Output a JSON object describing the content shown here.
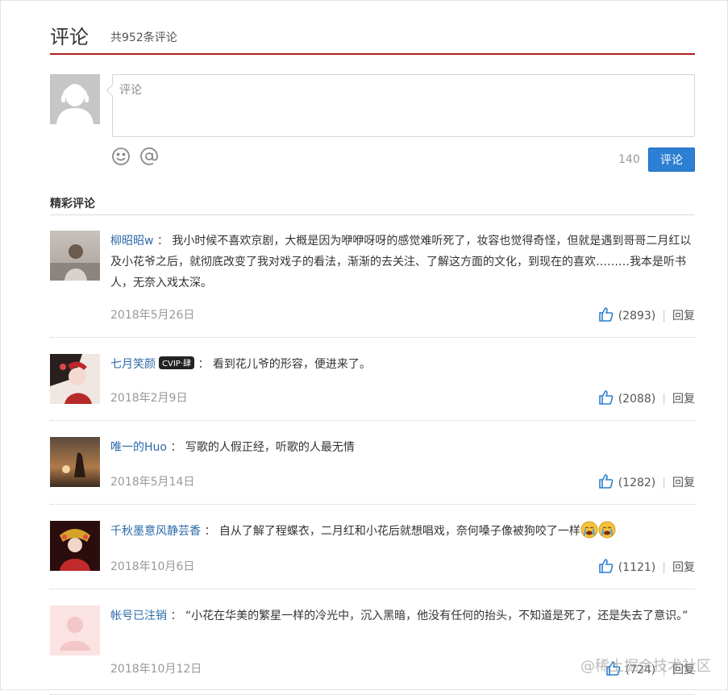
{
  "header": {
    "title": "评论",
    "count_text": "共952条评论"
  },
  "composer": {
    "placeholder": "评论",
    "char_limit": "140",
    "submit_label": "评论",
    "tools": [
      "smiley-icon",
      "at-icon"
    ]
  },
  "section_title": "精彩评论",
  "colors": {
    "accent": "#2c7fd2",
    "divider": "#b31d1d",
    "username": "#2b6aa8"
  },
  "comments": [
    {
      "user": "柳昭昭w",
      "text": "我小时候不喜欢京剧，大概是因为咿咿呀呀的感觉难听死了，妆容也觉得奇怪，但就是遇到哥哥二月红以及小花爷之后，就彻底改变了我对戏子的看法，渐渐的去关注、了解这方面的文化，到现在的喜欢………我本是听书人，无奈入戏太深。",
      "date": "2018年5月26日",
      "likes": "(2893)",
      "reply": "回复"
    },
    {
      "user": "七月笑颜",
      "badge": "CVIP·肆",
      "text": "看到花儿爷的形容，便进来了。",
      "date": "2018年2月9日",
      "likes": "(2088)",
      "reply": "回复"
    },
    {
      "user": "唯一的Huo",
      "text": "写歌的人假正经，听歌的人最无情",
      "date": "2018年5月14日",
      "likes": "(1282)",
      "reply": "回复"
    },
    {
      "user": "千秋墨意风静芸香",
      "text": "自从了解了程蝶衣，二月红和小花后就想唱戏，奈何嗓子像被狗咬了一样",
      "emoji": [
        "crying-face-icon",
        "crying-face-icon"
      ],
      "date": "2018年10月6日",
      "likes": "(1121)",
      "reply": "回复"
    },
    {
      "user": "帐号已注销",
      "text": "“小花在华美的繁星一样的冷光中，沉入黑暗，他没有任何的抬头，不知道是死了，还是失去了意识。”",
      "date": "2018年10月12日",
      "likes": "(724)",
      "reply": "回复"
    }
  ],
  "watermark": "@稀土掘金技术社区"
}
